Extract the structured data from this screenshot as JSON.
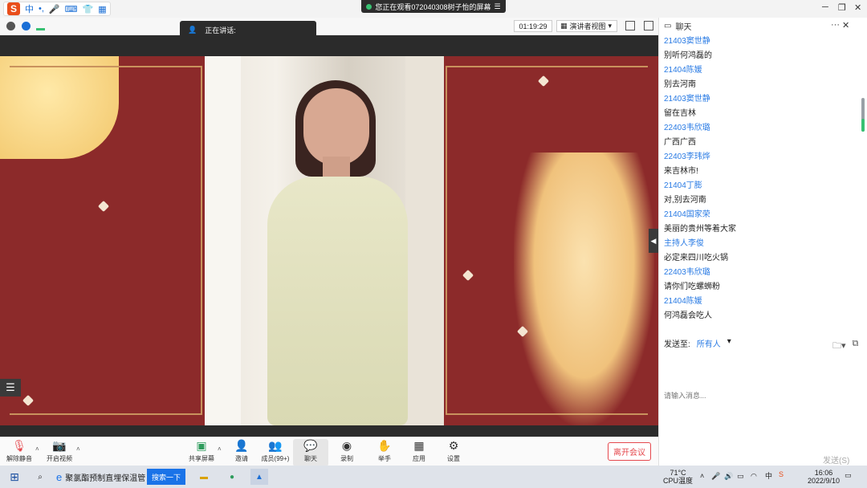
{
  "window": {
    "share_banner": "您正在观看072040308树子怡的屏幕",
    "speaking_label": "正在讲话:",
    "timer": "01:19:29",
    "view_mode": "演讲者视图",
    "ime_label": "中"
  },
  "chat": {
    "title": "聊天",
    "messages": [
      {
        "name": "21403窦世静",
        "text": "别听何鸿磊的"
      },
      {
        "name": "21404陈媛",
        "text": "别去河南"
      },
      {
        "name": "21403窦世静",
        "text": "留在吉林"
      },
      {
        "name": "22403韦欣璐",
        "text": "广西广西"
      },
      {
        "name": "22403李玮烨",
        "text": "来吉林市!"
      },
      {
        "name": "21404丁膨",
        "text": "对,别去河南"
      },
      {
        "name": "21404国家荣",
        "text": "美丽的贵州等着大家"
      },
      {
        "name": "主持人李俊",
        "text": "必定来四川吃火锅"
      },
      {
        "name": "22403韦欣璐",
        "text": "请你们吃螺蛳粉"
      },
      {
        "name": "21404陈媛",
        "text": "何鸿磊会吃人"
      }
    ],
    "send_to_label": "发送至:",
    "send_to_value": "所有人",
    "input_placeholder": "请输入消息...",
    "send_label": "发送(S)"
  },
  "toolbar": {
    "unmute": "解除静音",
    "start_video": "开启视频",
    "share_screen": "共享屏幕",
    "invite": "邀请",
    "members": "成员(99+)",
    "chat": "聊天",
    "record": "录制",
    "raise_hand": "举手",
    "apps": "应用",
    "settings": "设置",
    "leave": "离开会议"
  },
  "taskbar": {
    "browser_tab": "聚氯酯预制直埋保温管",
    "search_button": "搜索一下",
    "temp": "71°C",
    "cpu_label": "CPU温度",
    "time": "16:06",
    "date": "2022/9/10"
  },
  "colors": {
    "accent_blue": "#2a7be4",
    "leave_red": "#e5484d",
    "stage_red": "#8c2a2a"
  }
}
